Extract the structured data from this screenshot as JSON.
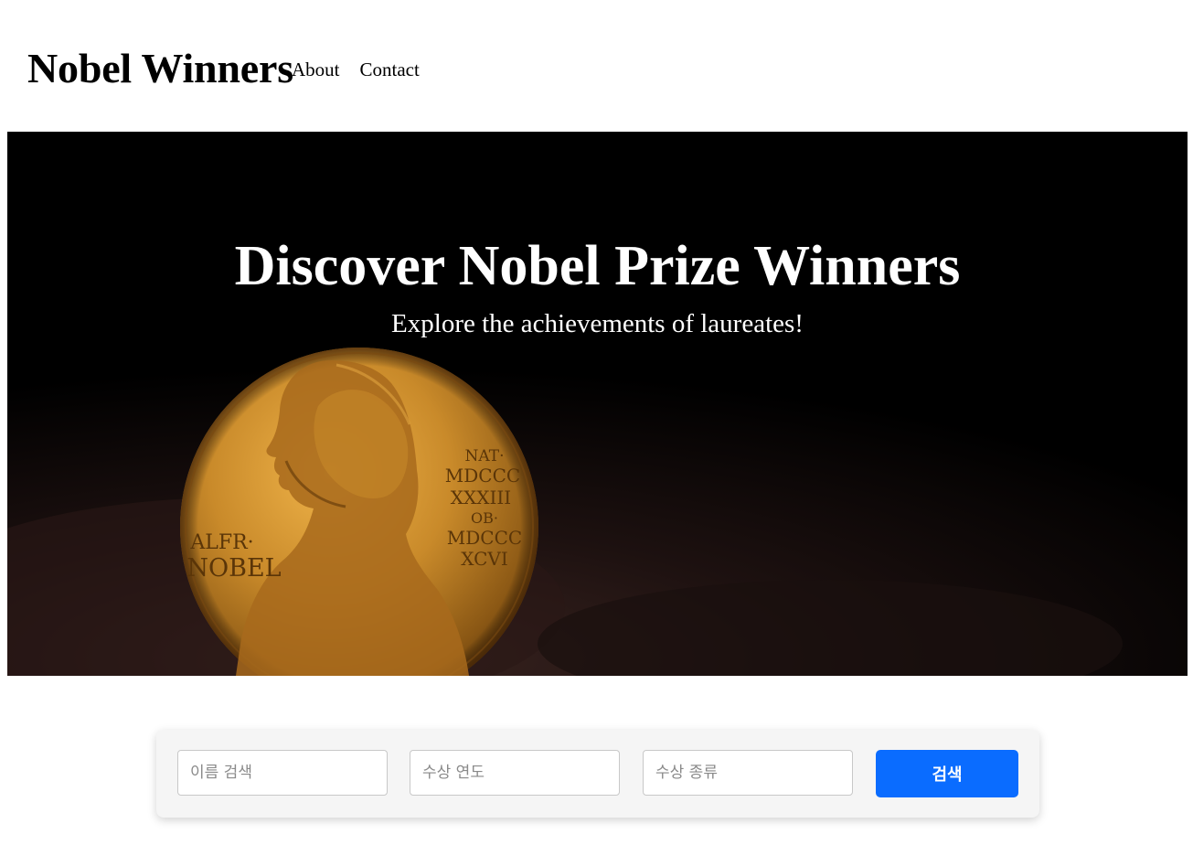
{
  "header": {
    "site_title": "Nobel Winners",
    "nav": [
      {
        "label": "About"
      },
      {
        "label": "Contact"
      }
    ]
  },
  "hero": {
    "title": "Discover Nobel Prize Winners",
    "subtitle": "Explore the achievements of laureates!",
    "medal": {
      "left_inscription_1": "ALFR·",
      "left_inscription_2": "NOBEL",
      "right_inscription_1": "NAT·",
      "right_inscription_2": "MDCCC",
      "right_inscription_3": "XXXIII",
      "right_inscription_4": "OB·",
      "right_inscription_5": "MDCCC",
      "right_inscription_6": "XCVI"
    }
  },
  "search": {
    "name_placeholder": "이름 검색",
    "year_placeholder": "수상 연도",
    "category_placeholder": "수상 종류",
    "button_label": "검색"
  },
  "colors": {
    "primary_button": "#0a6cff",
    "hero_background": "#000000",
    "medal_gold": "#c98a2a",
    "panel_background": "#f5f5f5"
  }
}
